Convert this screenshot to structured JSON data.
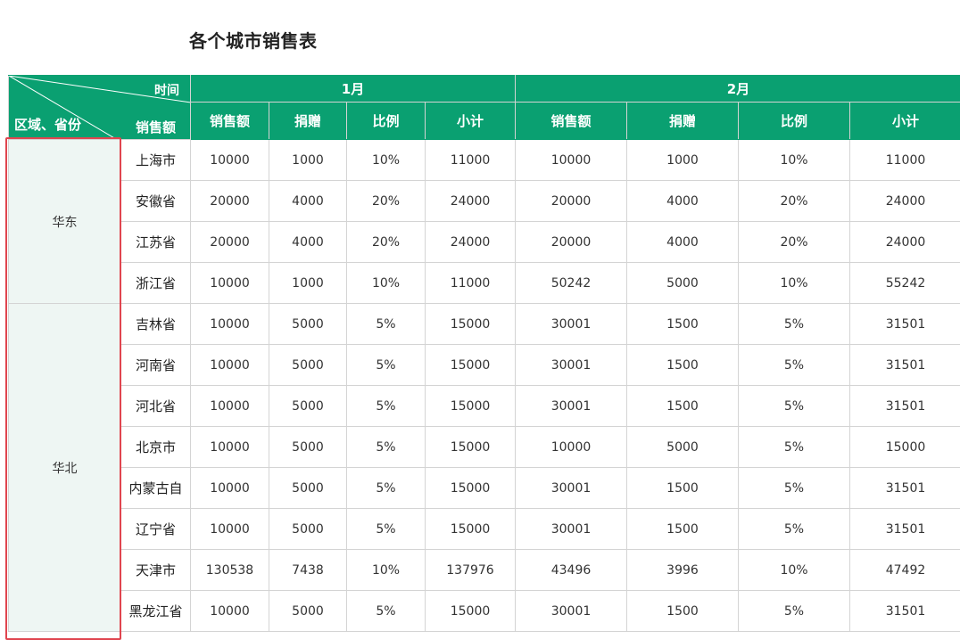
{
  "title": "各个城市销售表",
  "header": {
    "corner_time": "时间",
    "corner_sales": "销售额",
    "corner_region": "区域、省份",
    "months": [
      "1月",
      "2月"
    ],
    "metrics": [
      "销售额",
      "捐赠",
      "比例",
      "小计"
    ]
  },
  "colors": {
    "header_bg": "#0aa071",
    "region_bg": "#eef6f3",
    "highlight_border": "#e0454f"
  },
  "regions": [
    {
      "name": "华东",
      "rows": [
        {
          "province": "上海市",
          "m1": [
            "10000",
            "1000",
            "10%",
            "11000"
          ],
          "m2": [
            "10000",
            "1000",
            "10%",
            "11000"
          ]
        },
        {
          "province": "安徽省",
          "m1": [
            "20000",
            "4000",
            "20%",
            "24000"
          ],
          "m2": [
            "20000",
            "4000",
            "20%",
            "24000"
          ]
        },
        {
          "province": "江苏省",
          "m1": [
            "20000",
            "4000",
            "20%",
            "24000"
          ],
          "m2": [
            "20000",
            "4000",
            "20%",
            "24000"
          ]
        },
        {
          "province": "浙江省",
          "m1": [
            "10000",
            "1000",
            "10%",
            "11000"
          ],
          "m2": [
            "50242",
            "5000",
            "10%",
            "55242"
          ]
        }
      ]
    },
    {
      "name": "华北",
      "rows": [
        {
          "province": "吉林省",
          "m1": [
            "10000",
            "5000",
            "5%",
            "15000"
          ],
          "m2": [
            "30001",
            "1500",
            "5%",
            "31501"
          ]
        },
        {
          "province": "河南省",
          "m1": [
            "10000",
            "5000",
            "5%",
            "15000"
          ],
          "m2": [
            "30001",
            "1500",
            "5%",
            "31501"
          ]
        },
        {
          "province": "河北省",
          "m1": [
            "10000",
            "5000",
            "5%",
            "15000"
          ],
          "m2": [
            "30001",
            "1500",
            "5%",
            "31501"
          ]
        },
        {
          "province": "北京市",
          "m1": [
            "10000",
            "5000",
            "5%",
            "15000"
          ],
          "m2": [
            "10000",
            "5000",
            "5%",
            "15000"
          ]
        },
        {
          "province": "内蒙古自",
          "m1": [
            "10000",
            "5000",
            "5%",
            "15000"
          ],
          "m2": [
            "30001",
            "1500",
            "5%",
            "31501"
          ]
        },
        {
          "province": "辽宁省",
          "m1": [
            "10000",
            "5000",
            "5%",
            "15000"
          ],
          "m2": [
            "30001",
            "1500",
            "5%",
            "31501"
          ]
        },
        {
          "province": "天津市",
          "m1": [
            "130538",
            "7438",
            "10%",
            "137976"
          ],
          "m2": [
            "43496",
            "3996",
            "10%",
            "47492"
          ]
        },
        {
          "province": "黑龙江省",
          "m1": [
            "10000",
            "5000",
            "5%",
            "15000"
          ],
          "m2": [
            "30001",
            "1500",
            "5%",
            "31501"
          ]
        }
      ]
    }
  ]
}
